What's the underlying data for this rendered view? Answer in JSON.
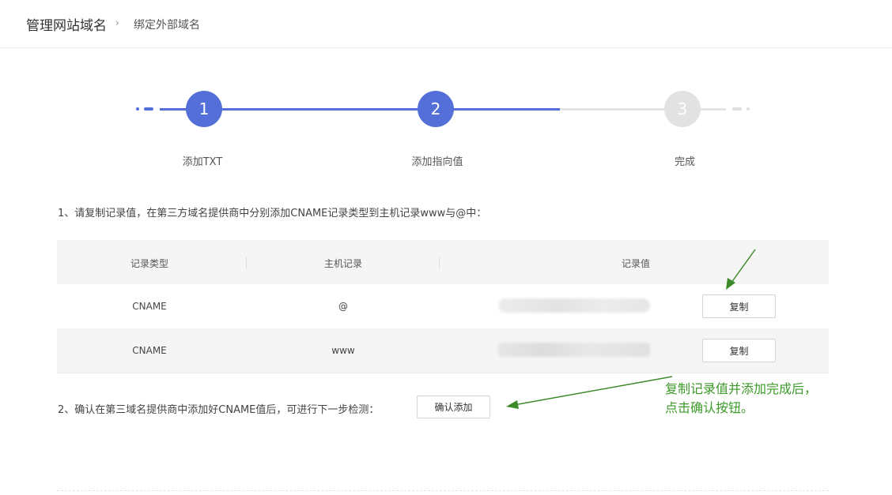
{
  "breadcrumb": {
    "root": "管理网站域名",
    "separator": "›",
    "current": "绑定外部域名"
  },
  "steps": [
    {
      "number": "1",
      "label": "添加TXT",
      "status": "done"
    },
    {
      "number": "2",
      "label": "添加指向值",
      "status": "active"
    },
    {
      "number": "3",
      "label": "完成",
      "status": "pending"
    }
  ],
  "instruction1": "1、请复制记录值，在第三方域名提供商中分别添加CNAME记录类型到主机记录www与@中：",
  "table": {
    "headers": [
      "记录类型",
      "主机记录",
      "记录值"
    ],
    "rows": [
      {
        "type": "CNAME",
        "host": "@",
        "copy_label": "复制"
      },
      {
        "type": "CNAME",
        "host": "www",
        "copy_label": "复制"
      }
    ]
  },
  "instruction2": "2、确认在第三域名提供商中添加好CNAME值后，可进行下一步检测：",
  "confirm_button": "确认添加",
  "annotation": {
    "line1": "复制记录值并添加完成后，",
    "line2": "点击确认按钮。"
  },
  "colors": {
    "accent": "#5470d8",
    "annotation": "#3d9a2a",
    "inactive": "#e2e2e2"
  }
}
